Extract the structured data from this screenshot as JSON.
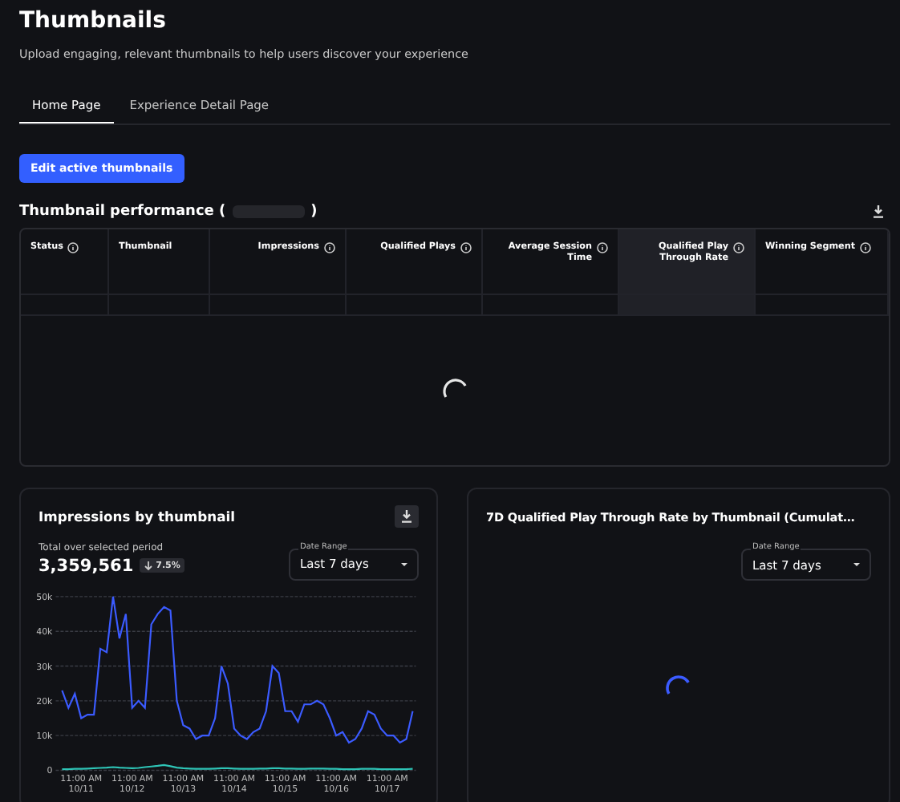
{
  "page": {
    "title": "Thumbnails",
    "subtitle": "Upload engaging, relevant thumbnails to help users discover your experience"
  },
  "tabs": [
    {
      "label": "Home Page",
      "selected": true
    },
    {
      "label": "Experience Detail Page",
      "selected": false
    }
  ],
  "edit_button": "Edit active thumbnails",
  "performance": {
    "title_start": "Thumbnail performance (",
    "title_end": ")",
    "loading": true,
    "columns": [
      {
        "label": "Status",
        "info": true,
        "highlighted": false
      },
      {
        "label": "Thumbnail",
        "info": false,
        "highlighted": false
      },
      {
        "label": "Impressions",
        "info": true,
        "highlighted": false
      },
      {
        "label": "Qualified Plays",
        "info": true,
        "highlighted": false
      },
      {
        "label": "Average Session Time",
        "info": true,
        "highlighted": false
      },
      {
        "label": "Qualified Play Through Rate",
        "info": true,
        "highlighted": true
      },
      {
        "label": "Winning Segment",
        "info": true,
        "highlighted": false
      }
    ]
  },
  "impressions_card": {
    "title": "Impressions by thumbnail",
    "total_label": "Total over selected period",
    "total": "3,359,561",
    "change": "7.5%",
    "date_range": {
      "label": "Date Range",
      "value": "Last 7 days"
    },
    "chart_data": {
      "type": "line",
      "grid": true,
      "categories": [
        null,
        null,
        null,
        "11:00 AM 10/11",
        null,
        null,
        null,
        null,
        null,
        null,
        null,
        "11:00 AM 10/12",
        null,
        null,
        null,
        null,
        null,
        null,
        null,
        "11:00 AM 10/13",
        null,
        null,
        null,
        null,
        null,
        null,
        null,
        "11:00 AM 10/14",
        null,
        null,
        null,
        null,
        null,
        null,
        null,
        "11:00 AM 10/15",
        null,
        null,
        null,
        null,
        null,
        null,
        null,
        "11:00 AM 10/16",
        null,
        null,
        null,
        null,
        null,
        null,
        null,
        "11:00 AM 10/17",
        null,
        null,
        null,
        null
      ],
      "series": [
        {
          "color": "#3b5bff",
          "values": [
            23000,
            18000,
            22000,
            15000,
            16000,
            16000,
            35000,
            34000,
            50000,
            38000,
            45000,
            18000,
            20000,
            18000,
            42000,
            45000,
            47000,
            46000,
            20000,
            13000,
            12000,
            9000,
            10000,
            10000,
            15000,
            30000,
            25000,
            12000,
            10000,
            9000,
            11000,
            12000,
            17000,
            30000,
            28000,
            17000,
            17000,
            14000,
            19000,
            19000,
            20000,
            19000,
            15000,
            10000,
            11000,
            8000,
            9000,
            12000,
            17000,
            16000,
            12000,
            10000,
            10000,
            8000,
            9000,
            17000
          ]
        },
        {
          "color": "#2ec4b6",
          "values": [
            300,
            300,
            400,
            400,
            500,
            600,
            700,
            800,
            900,
            800,
            700,
            600,
            700,
            900,
            1100,
            1300,
            1500,
            1200,
            800,
            600,
            500,
            400,
            400,
            400,
            500,
            600,
            600,
            500,
            400,
            400,
            400,
            500,
            500,
            600,
            600,
            500,
            500,
            400,
            400,
            500,
            500,
            500,
            400,
            400,
            300,
            300,
            300,
            400,
            400,
            400,
            300,
            300,
            300,
            300,
            300,
            400
          ]
        }
      ],
      "ylim": [
        0,
        50000
      ],
      "yticks": [
        {
          "value": 0,
          "label": "0"
        },
        {
          "value": 10000,
          "label": "10k"
        },
        {
          "value": 20000,
          "label": "20k"
        },
        {
          "value": 30000,
          "label": "30k"
        },
        {
          "value": 40000,
          "label": "40k"
        },
        {
          "value": 50000,
          "label": "50k"
        }
      ]
    }
  },
  "rate_card": {
    "title": "7D Qualified Play Through Rate by Thumbnail (Cumulat…",
    "loading": true,
    "date_range": {
      "label": "Date Range",
      "value": "Last 7 days"
    }
  }
}
